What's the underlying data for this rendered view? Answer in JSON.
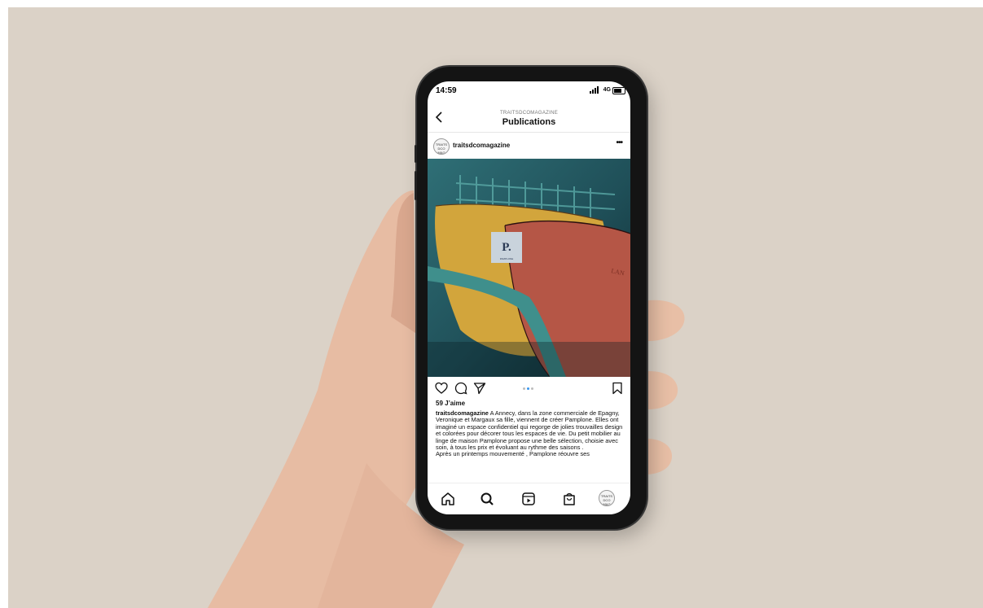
{
  "status_bar": {
    "time": "14:59",
    "network": "4G"
  },
  "header": {
    "account": "TRAITSDCOMAGAZINE",
    "title": "Publications"
  },
  "post": {
    "username": "traitsdcomagazine",
    "avatar_text": "TRAITS DCO MAG",
    "likes": "59 J’aime",
    "caption_user": "traitsdcomagazine",
    "caption_text": "A Annecy, dans la zone commerciale de Epagny, Veronique et Margaux sa fille, viennent de créer Pamplone. Elles ont imaginé un espace confidentiel qui regorge de jolies trouvailles design et colorées pour décorer tous les espaces de vie. Du petit mobilier au linge de maison Pamplone propose une belle sélection, choisie avec soin, à tous les prix et évoluant au rythme des saisons .",
    "caption_more": "Après un printemps mouvementé , Pamplone réouvre ses",
    "carousel_active": 2,
    "carousel_count": 3
  },
  "icons": {
    "back": "chevron-left-icon",
    "more": "more-horizontal-icon",
    "like": "heart-icon",
    "comment": "comment-icon",
    "share": "send-icon",
    "save": "bookmark-icon",
    "nav": [
      "home-icon",
      "search-icon",
      "reels-icon",
      "shop-icon",
      "profile-icon"
    ]
  },
  "colors": {
    "background": "#dbd2c7",
    "carousel_active": "#3897f0"
  }
}
